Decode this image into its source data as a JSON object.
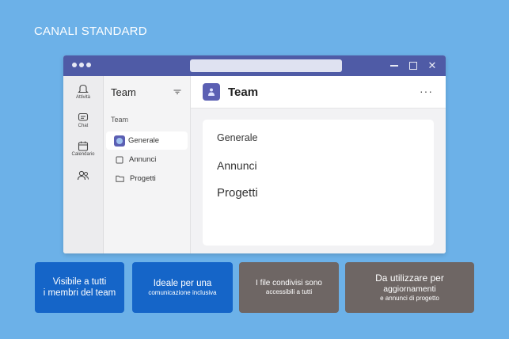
{
  "slide": {
    "title": "CANALI STANDARD"
  },
  "rail": {
    "items": [
      {
        "label": "Attività",
        "icon": "bell-icon"
      },
      {
        "label": "Chat",
        "icon": "chat-icon"
      },
      {
        "label": "Calendario",
        "icon": "calendar-icon"
      },
      {
        "label": "",
        "icon": "people-icon"
      }
    ]
  },
  "channels": {
    "header": "Team",
    "section": "Team",
    "items": [
      {
        "label": "Generale"
      },
      {
        "label": "Annunci"
      },
      {
        "label": "Progetti"
      }
    ]
  },
  "main": {
    "title": "Team",
    "more": "···",
    "card_items": [
      "Generale",
      "Annunci",
      "Progetti"
    ]
  },
  "features": [
    {
      "line1": "Visibile a tutti",
      "line2": "i membri del team",
      "color": "#1565c8"
    },
    {
      "line1": "Ideale per una",
      "line2": "comunicazione inclusiva",
      "color": "#1565c8"
    },
    {
      "line1": "I file condivisi sono",
      "line2": "accessibili a tutti",
      "color": "#6e6664"
    },
    {
      "line1": "Da utilizzare per",
      "line2": "aggiornamenti",
      "line3": "e annunci di progetto",
      "color": "#6e6664"
    }
  ],
  "colors": {
    "background": "#6cb1e8",
    "titlebar": "#4f5ba6",
    "accent": "#5b5fb3"
  }
}
